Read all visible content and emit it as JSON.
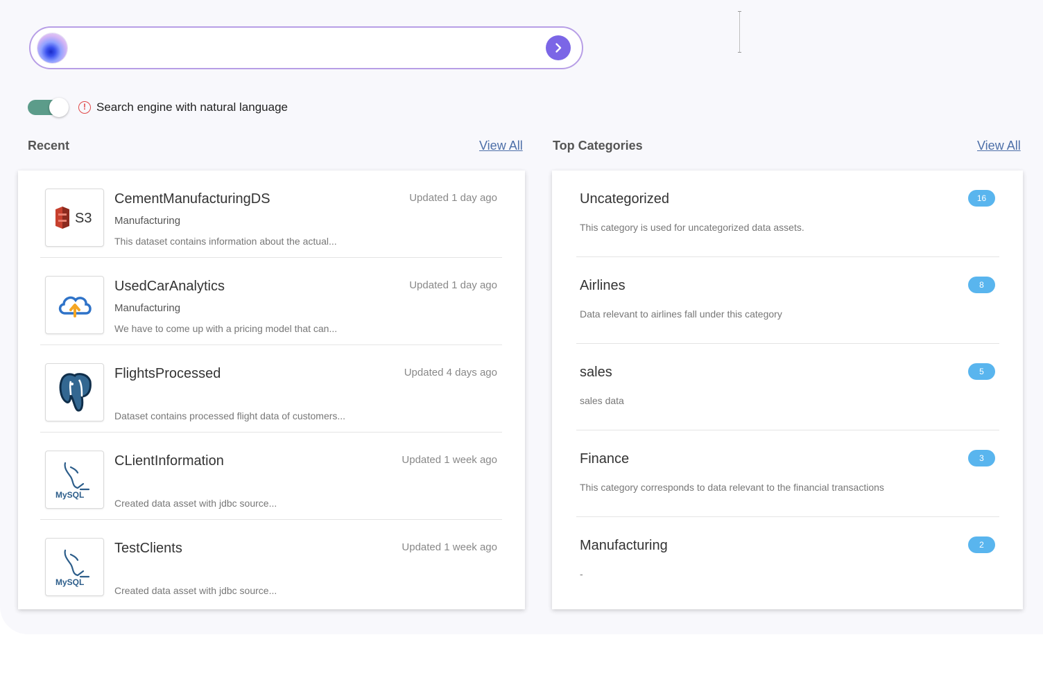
{
  "search": {
    "value": "",
    "placeholder": "",
    "submit_icon": "chevron-right-icon"
  },
  "toggle": {
    "enabled": true,
    "label": "Search engine with natural language",
    "info_icon": "alert-circle-icon"
  },
  "recent": {
    "title": "Recent",
    "view_all": "View All",
    "items": [
      {
        "name": "CementManufacturingDS",
        "category": "Manufacturing",
        "description": "This dataset contains information about the actual...",
        "updated": "Updated 1 day ago",
        "icon": "aws-s3-icon",
        "icon_text": "S3"
      },
      {
        "name": "UsedCarAnalytics",
        "category": "Manufacturing",
        "description": "We have to come up with a pricing model that can...",
        "updated": "Updated 1 day ago",
        "icon": "cloud-upload-icon"
      },
      {
        "name": "FlightsProcessed",
        "category": "",
        "description": "Dataset contains processed flight data of customers...",
        "updated": "Updated 4 days ago",
        "icon": "postgresql-icon"
      },
      {
        "name": "CLientInformation",
        "category": "",
        "description": "Created data asset with jdbc source...",
        "updated": "Updated 1 week ago",
        "icon": "mysql-icon",
        "icon_text": "MySQL"
      },
      {
        "name": "TestClients",
        "category": "",
        "description": "Created data asset with jdbc source...",
        "updated": "Updated 1 week ago",
        "icon": "mysql-icon",
        "icon_text": "MySQL"
      }
    ]
  },
  "categories": {
    "title": "Top Categories",
    "view_all": "View All",
    "items": [
      {
        "name": "Uncategorized",
        "description": "This category is used for uncategorized data assets.",
        "count": "16"
      },
      {
        "name": "Airlines",
        "description": "Data relevant to airlines fall under this category",
        "count": "8"
      },
      {
        "name": "sales",
        "description": "sales data",
        "count": "5"
      },
      {
        "name": "Finance",
        "description": "This category corresponds to data relevant to the financial transactions",
        "count": "3"
      },
      {
        "name": "Manufacturing",
        "description": "-",
        "count": "2"
      }
    ]
  },
  "colors": {
    "accent": "#7b66e6",
    "toggle_on": "#5c9c8a",
    "badge": "#59b5ee",
    "link": "#4d6fa8",
    "alert": "#e04848"
  }
}
